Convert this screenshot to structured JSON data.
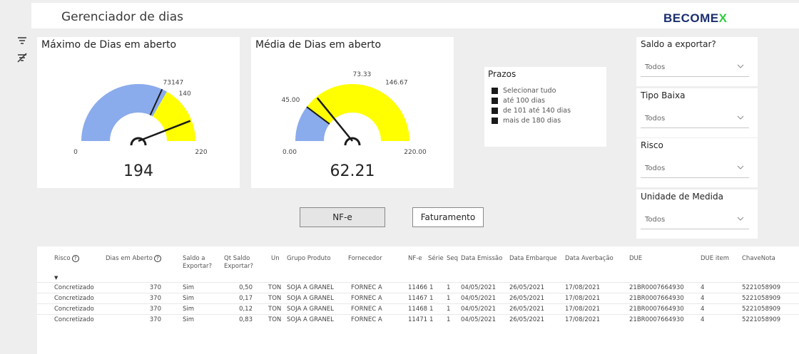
{
  "app": {
    "title": "Gerenciador de dias",
    "logo_main": "BECOME",
    "logo_x": "X"
  },
  "sidebar": {
    "icons": [
      "filter-icon",
      "clear-filter-icon"
    ]
  },
  "gauge_max": {
    "title": "Máximo de Dias em aberto",
    "value": "194",
    "min_label": "0",
    "max_label": "220",
    "mark1_label": "73",
    "mark2_label": "140",
    "mark3_label": "147",
    "min": 0,
    "max": 220,
    "needle": 194,
    "target": 140,
    "bands": [
      {
        "from": 0,
        "to": 146.67,
        "color": "#8aabec"
      },
      {
        "from": 146.67,
        "to": 220,
        "color": "#ffff00"
      }
    ]
  },
  "gauge_avg": {
    "title": "Média de Dias em aberto",
    "value": "62.21",
    "min_label": "0.00",
    "max_label": "220.00",
    "mark1_label": "45.00",
    "mark2_label": "73.33",
    "mark3_label": "146.67",
    "min": 0,
    "max": 220,
    "needle": 62.21,
    "target": 45,
    "bands": [
      {
        "from": 0,
        "to": 45,
        "color": "#8aabec"
      },
      {
        "from": 45,
        "to": 220,
        "color": "#ffff00"
      }
    ]
  },
  "prazos": {
    "title": "Prazos",
    "items": [
      "Selecionar tudo",
      "até 100 dias",
      "de 101 até 140 dias",
      "mais de 180 dias"
    ]
  },
  "slicers": [
    {
      "title": "Saldo a exportar?",
      "value": "Todos"
    },
    {
      "title": "Tipo Baixa",
      "value": "Todos"
    },
    {
      "title": "Risco",
      "value": "Todos"
    },
    {
      "title": "Unidade de Medida",
      "value": "Todos"
    }
  ],
  "buttons": {
    "nfe": "NF-e",
    "faturamento": "Faturamento"
  },
  "table": {
    "headers": {
      "risco": "Risco",
      "dias": "Dias em Aberto",
      "saldo1": "Saldo a",
      "saldo2": "Exportar?",
      "qt1": "Qt Saldo",
      "qt2": "Exportar?",
      "un": "Un",
      "grupo": "Grupo Produto",
      "fornecedor": "Fornecedor",
      "nfe": "NF-e",
      "serie": "Série",
      "seq": "Seq",
      "emissao": "Data Emissão",
      "embarque": "Data Embarque",
      "averbacao": "Data Averbação",
      "due": "DUE",
      "dueitem": "DUE item",
      "chave": "ChaveNota"
    },
    "help_glyph": "?",
    "sort_glyph": "▼",
    "rows": [
      {
        "risco": "Concretizado",
        "dias": "370",
        "saldo": "Sim",
        "qt": "0,50",
        "un": "TON",
        "grupo": "SOJA A GRANEL",
        "fornecedor": "FORNEC A",
        "nfe": "11466",
        "serie": "1",
        "seq": "1",
        "emissao": "04/05/2021",
        "embarque": "26/05/2021",
        "averbacao": "17/08/2021",
        "due": "21BR0007664930",
        "dueitem": "4",
        "chave": "5221058909"
      },
      {
        "risco": "Concretizado",
        "dias": "370",
        "saldo": "Sim",
        "qt": "0,17",
        "un": "TON",
        "grupo": "SOJA A GRANEL",
        "fornecedor": "FORNEC A",
        "nfe": "11467",
        "serie": "1",
        "seq": "1",
        "emissao": "04/05/2021",
        "embarque": "26/05/2021",
        "averbacao": "17/08/2021",
        "due": "21BR0007664930",
        "dueitem": "4",
        "chave": "5221058909"
      },
      {
        "risco": "Concretizado",
        "dias": "370",
        "saldo": "Sim",
        "qt": "0,12",
        "un": "TON",
        "grupo": "SOJA A GRANEL",
        "fornecedor": "FORNEC A",
        "nfe": "11468",
        "serie": "1",
        "seq": "1",
        "emissao": "04/05/2021",
        "embarque": "26/05/2021",
        "averbacao": "17/08/2021",
        "due": "21BR0007664930",
        "dueitem": "4",
        "chave": "5221058909"
      },
      {
        "risco": "Concretizado",
        "dias": "370",
        "saldo": "Sim",
        "qt": "0,83",
        "un": "TON",
        "grupo": "SOJA A GRANEL",
        "fornecedor": "FORNEC A",
        "nfe": "11471",
        "serie": "1",
        "seq": "1",
        "emissao": "04/05/2021",
        "embarque": "26/05/2021",
        "averbacao": "17/08/2021",
        "due": "21BR0007664930",
        "dueitem": "4",
        "chave": "5221058909"
      }
    ]
  },
  "colors": {
    "accent_blue": "#8aabec",
    "accent_yellow": "#ffff00",
    "logo_navy": "#1a2e6e",
    "logo_green": "#2ecc40"
  }
}
